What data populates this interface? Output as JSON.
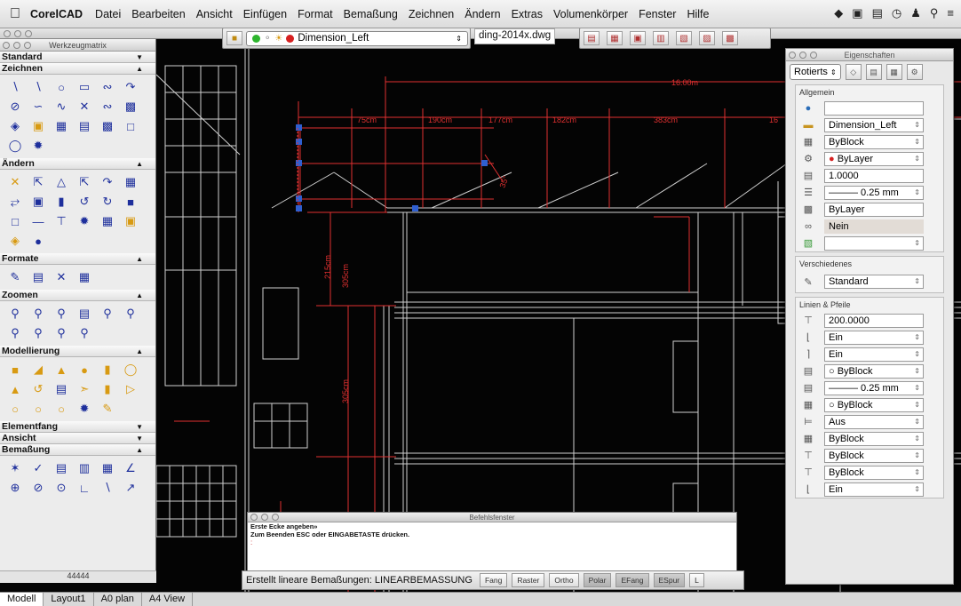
{
  "menubar": {
    "app": "CorelCAD",
    "items": [
      "Datei",
      "Bearbeiten",
      "Ansicht",
      "Einfügen",
      "Format",
      "Bemaßung",
      "Zeichnen",
      "Ändern",
      "Extras",
      "Volumenkörper",
      "Fenster",
      "Hilfe"
    ]
  },
  "toolbar": {
    "layer_name": "Dimension_Left",
    "file_name": "ding-2014x.dwg"
  },
  "palette": {
    "title": "Werkzeugmatrix",
    "sections": {
      "standard": "Standard",
      "zeichnen": "Zeichnen",
      "andern": "Ändern",
      "formate": "Formate",
      "zoomen": "Zoomen",
      "modellierung": "Modellierung",
      "elementfang": "Elementfang",
      "ansicht": "Ansicht",
      "bemassung": "Bemaßung"
    },
    "footer": "44444"
  },
  "drawing": {
    "dims": [
      "16.00m",
      "75cm",
      "190cm",
      "177cm",
      "182cm",
      "383cm",
      "16",
      "35°",
      "215cm",
      "305cm",
      "305cm",
      "305cm"
    ]
  },
  "properties": {
    "title": "Eigenschaften",
    "rotate_label": "Rotierts",
    "groups": {
      "allgemein": "Allgemein",
      "verschiedenes": "Verschiedenes",
      "linien": "Linien & Pfeile"
    },
    "allgemein_rows": [
      "",
      "Dimension_Left",
      "ByBlock",
      "ByLayer",
      "1.0000",
      "——— 0.25 mm",
      "ByLayer",
      "Nein",
      ""
    ],
    "verschiedenes_value": "Standard",
    "linien_rows": [
      "200.0000",
      "Ein",
      "Ein",
      "ByBlock",
      "——— 0.25 mm",
      "ByBlock",
      "Aus",
      "ByBlock",
      "ByBlock",
      "ByBlock",
      "Ein"
    ]
  },
  "command": {
    "title": "Befehlsfenster",
    "line1": "Erste Ecke angeben»",
    "line2": "Zum Beenden ESC oder EINGABETASTE drücken.",
    "prompt": ":"
  },
  "status": {
    "message": "Erstellt lineare Bemaßungen: LINEARBEMASSUNG",
    "buttons": [
      "Fang",
      "Raster",
      "Ortho",
      "Polar",
      "EFang",
      "ESpur",
      "L"
    ]
  },
  "tabs": [
    "Modell",
    "Layout1",
    "A0 plan",
    "A4 View"
  ],
  "colors": {
    "dim": "#e03030",
    "grip": "#2f5fd0",
    "lines": "#d8d8d8"
  }
}
